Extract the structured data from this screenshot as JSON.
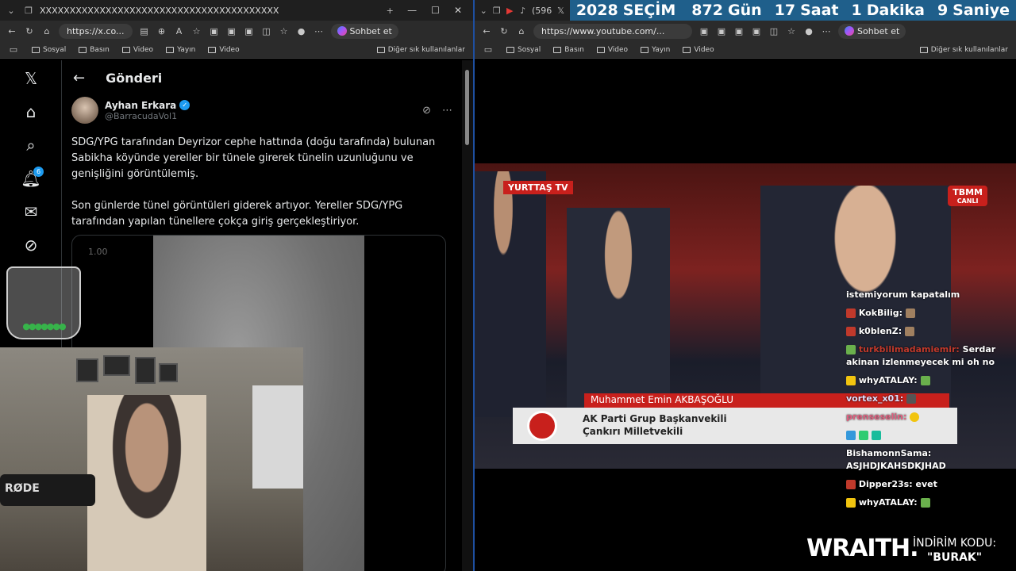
{
  "left_browser": {
    "tab_strip": "XXXXXXXXXXXXXXXXXXXXXXXXXXXXXXXXXXXXXXXX",
    "url": "https://x.co...",
    "copilot_label": "Sohbet et",
    "bookmarks": [
      "Sosyal",
      "Basın",
      "Video",
      "Yayın",
      "Video"
    ],
    "other_bookmarks": "Diğer sık kullanılanlar"
  },
  "x_page": {
    "header_title": "Gönderi",
    "notification_count": "6",
    "author_name": "Ayhan Erkara",
    "author_handle": "@BarracudaVol1",
    "paragraph_1": "SDG/YPG tarafından Deyrizor cephe hattında (doğu tarafında) bulunan Sabikha köyünde yereller bir tünele girerek tünelin uzunluğunu ve genişliğini görüntülemiş.",
    "paragraph_2": "Son günlerde tünel görüntüleri giderek artıyor. Yereller SDG/YPG tarafından yapılan tünellere çokça giriş gerçekleştiriyor.",
    "video_time": "1.00"
  },
  "webcam": {
    "mic_brand": "RØDE"
  },
  "right_browser": {
    "tab_count": "(596",
    "url": "https://www.youtube.com/...",
    "copilot_label": "Sohbet et",
    "bookmarks": [
      "Sosyal",
      "Basın",
      "Video",
      "Yayın",
      "Video"
    ],
    "other_bookmarks": "Diğer sık kullanılanlar"
  },
  "countdown": {
    "year": "2028",
    "label": "SEÇİM",
    "days": "872",
    "days_unit": "Gün",
    "hours": "17",
    "hours_unit": "Saat",
    "minutes": "1",
    "minutes_unit": "Dakika",
    "seconds": "9",
    "seconds_unit": "Saniye"
  },
  "broadcast": {
    "channel_logo": "YURTTAŞ TV",
    "tbmm_logo": "TBMM",
    "tbmm_live": "CANLI",
    "speaker_name": "Muhammet Emin AKBAŞOĞLU",
    "speaker_title": "AK Parti Grup Başkanvekili",
    "speaker_region": "Çankırı Milletvekili"
  },
  "chat": [
    {
      "user": "",
      "text": "istemiyorum kapatalım"
    },
    {
      "user": "KokBilig:",
      "text": ""
    },
    {
      "user": "k0blenZ:",
      "text": ""
    },
    {
      "user": "turkbilimadamiemir:",
      "text": "Serdar akinan izlenmeyecek mi oh no"
    },
    {
      "user": "whyATALAY:",
      "text": ""
    },
    {
      "user": "vortex_x01:",
      "text": ""
    },
    {
      "user": "prenseselin:",
      "text": ""
    },
    {
      "user": "BishamonnSama:",
      "text": "ASJHDJKAHSDKJHAD"
    },
    {
      "user": "Dipper23s:",
      "text": "evet"
    },
    {
      "user": "whyATALAY:",
      "text": ""
    }
  ],
  "sponsor": {
    "brand": "WRAITH.",
    "promo_label": "İNDİRİM KODU:",
    "promo_code": "\"BURAK\""
  },
  "colors": {
    "x_blue": "#1d9bf0",
    "countdown_bg": "#1f5f8b",
    "tbmm_red": "#c8201c"
  }
}
